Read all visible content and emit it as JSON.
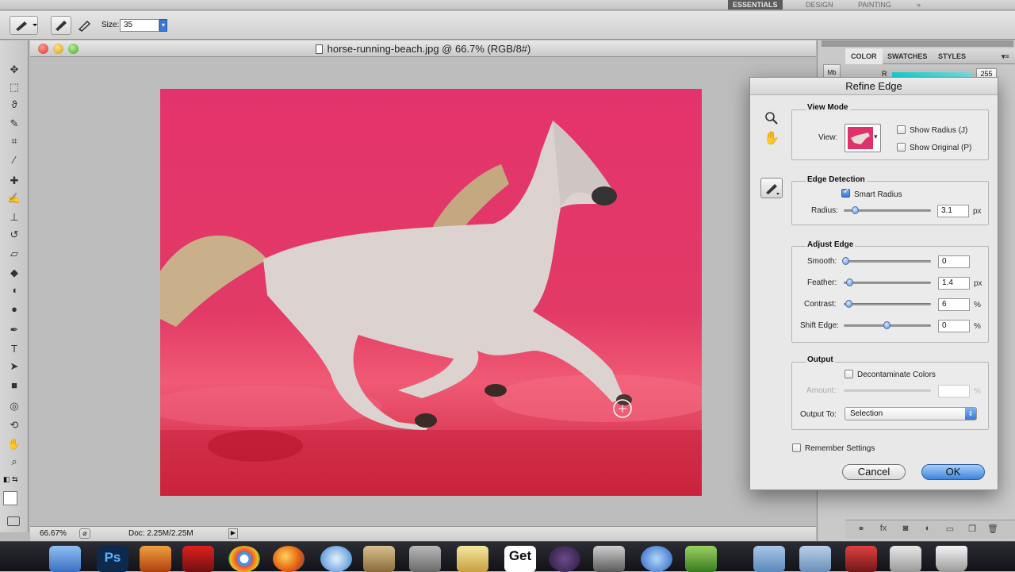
{
  "app": {
    "workspaces": [
      "ESSENTIALS",
      "DESIGN",
      "PAINTING"
    ],
    "workspace_extra": "»",
    "colors": {
      "accent": "#3a78d4",
      "canvas_overlay": "#e0316a"
    }
  },
  "options_bar": {
    "size_label": "Size:",
    "size_value": "35"
  },
  "document": {
    "title": "horse-running-beach.jpg @ 66.7% (RGB/8#)",
    "zoom": "66.67%",
    "doc_info": "Doc: 2.25M/2.25M"
  },
  "right_panel": {
    "tabs": [
      "COLOR",
      "SWATCHES",
      "STYLES"
    ],
    "r_label": "R",
    "r_value": "255"
  },
  "refine_edge": {
    "title": "Refine Edge",
    "view_mode": {
      "heading": "View Mode",
      "view_label": "View:",
      "show_radius": "Show Radius (J)",
      "show_original": "Show Original (P)"
    },
    "edge_detection": {
      "heading": "Edge Detection",
      "smart_radius": "Smart Radius",
      "radius_label": "Radius:",
      "radius_value": "3.1",
      "radius_unit": "px",
      "radius_level": 0.12
    },
    "adjust_edge": {
      "heading": "Adjust Edge",
      "smooth_label": "Smooth:",
      "smooth_value": "0",
      "feather_label": "Feather:",
      "feather_value": "1.4",
      "feather_unit": "px",
      "contrast_label": "Contrast:",
      "contrast_value": "6",
      "contrast_unit": "%",
      "shift_label": "Shift Edge:",
      "shift_value": "0",
      "shift_unit": "%"
    },
    "output": {
      "heading": "Output",
      "decontaminate": "Decontaminate Colors",
      "amount_label": "Amount:",
      "amount_unit": "%",
      "output_to_label": "Output To:",
      "output_to_value": "Selection"
    },
    "remember": "Remember Settings",
    "cancel": "Cancel",
    "ok": "OK"
  },
  "dock": {
    "ps_label": "Ps",
    "get_label": "Get"
  }
}
